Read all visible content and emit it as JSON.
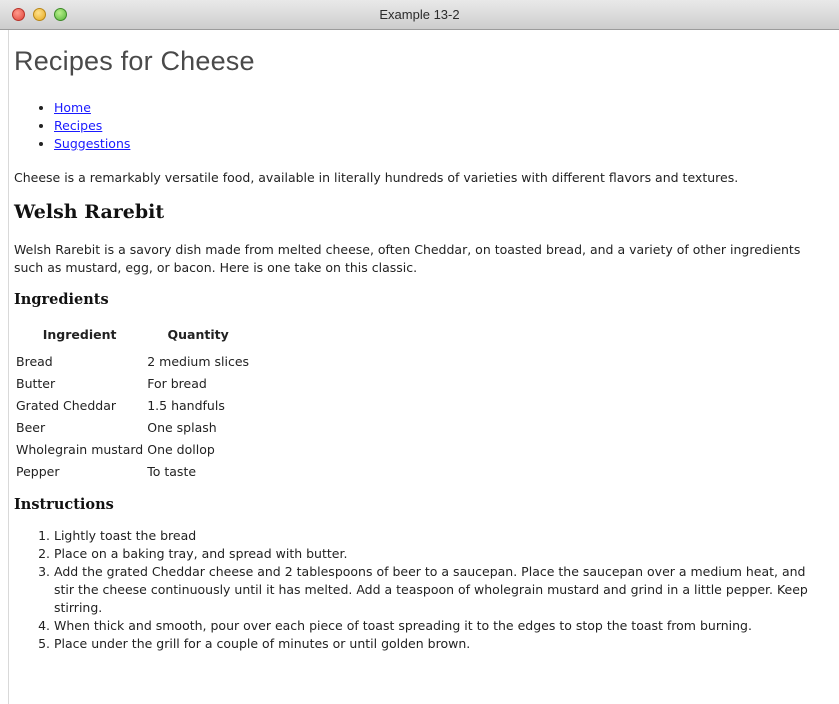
{
  "window": {
    "title": "Example 13-2"
  },
  "page": {
    "title": "Recipes for Cheese",
    "nav": [
      {
        "label": "Home"
      },
      {
        "label": "Recipes"
      },
      {
        "label": "Suggestions"
      }
    ],
    "intro": "Cheese is a remarkably versatile food, available in literally hundreds of varieties with different flavors and textures."
  },
  "recipe": {
    "title": "Welsh Rarebit",
    "description": "Welsh Rarebit is a savory dish made from melted cheese, often Cheddar, on toasted bread, and a variety of other ingredients such as mustard, egg, or bacon. Here is one take on this classic.",
    "ingredients_heading": "Ingredients",
    "table": {
      "headers": [
        "Ingredient",
        "Quantity"
      ],
      "rows": [
        [
          "Bread",
          "2 medium slices"
        ],
        [
          "Butter",
          "For bread"
        ],
        [
          "Grated Cheddar",
          "1.5 handfuls"
        ],
        [
          "Beer",
          "One splash"
        ],
        [
          "Wholegrain mustard",
          "One dollop"
        ],
        [
          "Pepper",
          "To taste"
        ]
      ]
    },
    "instructions_heading": "Instructions",
    "steps": [
      "Lightly toast the bread",
      "Place on a baking tray, and spread with butter.",
      "Add the grated Cheddar cheese and 2 tablespoons of beer to a saucepan. Place the saucepan over a medium heat, and stir the cheese continuously until it has melted. Add a teaspoon of wholegrain mustard and grind in a little pepper. Keep stirring.",
      "When thick and smooth, pour over each piece of toast spreading it to the edges to stop the toast from burning.",
      "Place under the grill for a couple of minutes or until golden brown."
    ]
  },
  "colors": {
    "link": "#1a1aff",
    "close_button": "#e0443a",
    "minimize_button": "#e5a91f",
    "zoom_button": "#55b43a"
  }
}
